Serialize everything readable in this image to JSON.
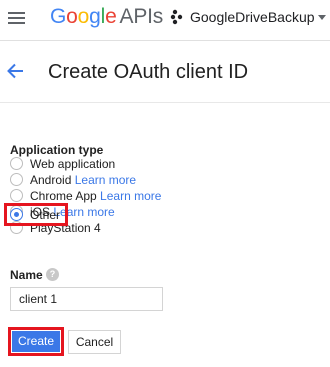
{
  "header": {
    "logo_google": [
      "G",
      "o",
      "o",
      "g",
      "l",
      "e"
    ],
    "logo_colors": [
      "#4285f4",
      "#ea4335",
      "#fbbc05",
      "#4285f4",
      "#34a853",
      "#ea4335"
    ],
    "logo_apis": "APIs",
    "project_name": "GoogleDriveBackup"
  },
  "page": {
    "title": "Create OAuth client ID"
  },
  "form": {
    "app_type_label": "Application type",
    "options": [
      {
        "label": "Web application",
        "learn": "",
        "checked": false
      },
      {
        "label": "Android",
        "learn": "Learn more",
        "checked": false
      },
      {
        "label": "Chrome App",
        "learn": "Learn more",
        "checked": false
      },
      {
        "label": "iOS",
        "learn": "Learn more",
        "checked": false
      },
      {
        "label": "PlayStation 4",
        "learn": "",
        "checked": false
      },
      {
        "label": "Other",
        "learn": "",
        "checked": true
      }
    ],
    "name_label": "Name",
    "help_glyph": "?",
    "name_value": "client 1",
    "create_label": "Create",
    "cancel_label": "Cancel"
  },
  "colors": {
    "accent": "#3b78e7",
    "highlight": "#e5151f"
  }
}
